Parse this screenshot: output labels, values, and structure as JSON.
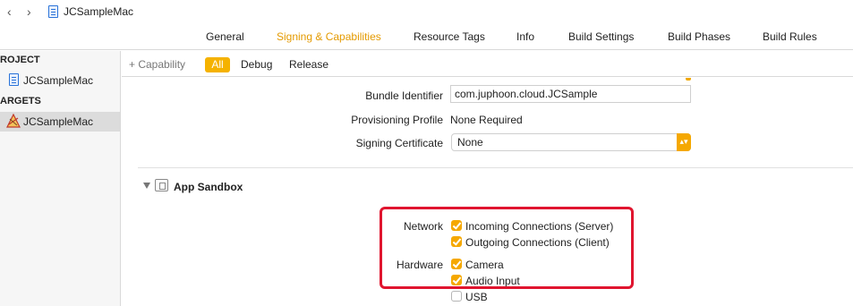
{
  "topbar": {
    "back_icon": "chevron-left-icon",
    "forward_icon": "chevron-right-icon",
    "crumb": "JCSampleMac"
  },
  "tabs": [
    {
      "label": "General"
    },
    {
      "label": "Signing & Capabilities",
      "active": true
    },
    {
      "label": "Resource Tags"
    },
    {
      "label": "Info"
    },
    {
      "label": "Build Settings"
    },
    {
      "label": "Build Phases"
    },
    {
      "label": "Build Rules"
    }
  ],
  "sidebar": {
    "project_header": "ROJECT",
    "project_item": "JCSampleMac",
    "targets_header": "ARGETS",
    "target_item": "JCSampleMac"
  },
  "subbar": {
    "capability": "+ Capability",
    "all": "All",
    "debug": "Debug",
    "release": "Release"
  },
  "signing": {
    "bundle_label": "Bundle Identifier",
    "bundle_value": "com.juphoon.cloud.JCSample",
    "profile_label": "Provisioning Profile",
    "profile_value": "None Required",
    "cert_label": "Signing Certificate",
    "cert_value": "None"
  },
  "sandbox": {
    "title": "App Sandbox",
    "network_label": "Network",
    "incoming": "Incoming Connections (Server)",
    "outgoing": "Outgoing Connections (Client)",
    "hardware_label": "Hardware",
    "camera": "Camera",
    "audio": "Audio Input",
    "usb": "USB"
  },
  "colors": {
    "accent": "#f5a800",
    "highlight_box": "#e0152f"
  }
}
